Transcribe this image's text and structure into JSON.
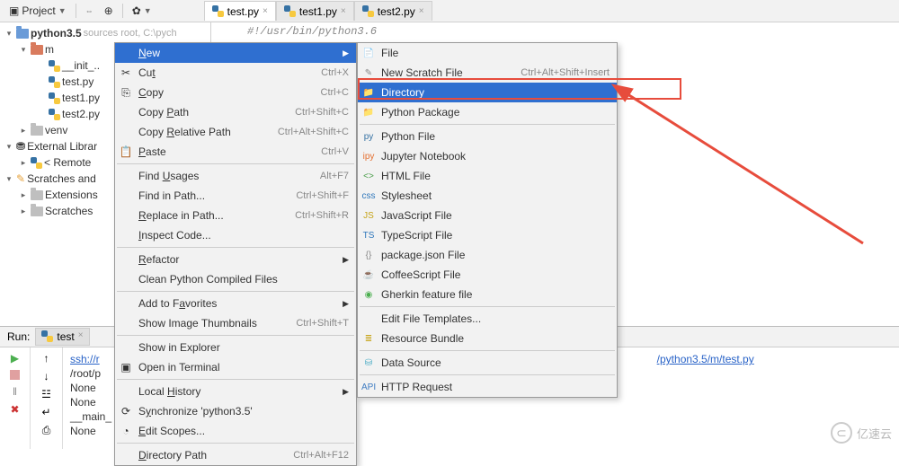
{
  "toolbar": {
    "project_label": "Project"
  },
  "tabs": [
    {
      "name": "test.py",
      "active": true
    },
    {
      "name": "test1.py",
      "active": false
    },
    {
      "name": "test2.py",
      "active": false
    }
  ],
  "tree": {
    "root": "python3.5",
    "root_hint": "sources root, C:\\pych",
    "m": "m",
    "files": [
      "__init_..",
      "test.py",
      "test1.py",
      "test2.py"
    ],
    "venv": "venv",
    "external": "External Librar",
    "remote": "< Remote",
    "scratches_root": "Scratches and",
    "extensions": "Extensions",
    "scratches": "Scratches"
  },
  "editor": {
    "line1": "#!/usr/bin/python3.6"
  },
  "context_menu": {
    "items": [
      {
        "label": "New",
        "hi": true,
        "arrow": true,
        "underline_idx": 0
      },
      {
        "label": "Cut",
        "shortcut": "Ctrl+X",
        "icon": "cut",
        "underline_idx": 2
      },
      {
        "label": "Copy",
        "shortcut": "Ctrl+C",
        "icon": "copy",
        "underline_idx": 0
      },
      {
        "label": "Copy Path",
        "shortcut": "Ctrl+Shift+C",
        "underline_idx": 5
      },
      {
        "label": "Copy Relative Path",
        "shortcut": "Ctrl+Alt+Shift+C",
        "underline_idx": 5
      },
      {
        "label": "Paste",
        "shortcut": "Ctrl+V",
        "icon": "paste",
        "underline_idx": 0
      },
      {
        "sep": true
      },
      {
        "label": "Find Usages",
        "shortcut": "Alt+F7",
        "underline_idx": 5
      },
      {
        "label": "Find in Path...",
        "shortcut": "Ctrl+Shift+F"
      },
      {
        "label": "Replace in Path...",
        "shortcut": "Ctrl+Shift+R",
        "underline_idx": 0
      },
      {
        "label": "Inspect Code...",
        "underline_idx": 0
      },
      {
        "sep": true
      },
      {
        "label": "Refactor",
        "arrow": true,
        "underline_idx": 0
      },
      {
        "label": "Clean Python Compiled Files"
      },
      {
        "sep": true
      },
      {
        "label": "Add to Favorites",
        "arrow": true,
        "underline_idx": 8
      },
      {
        "label": "Show Image Thumbnails",
        "shortcut": "Ctrl+Shift+T"
      },
      {
        "sep": true
      },
      {
        "label": "Show in Explorer"
      },
      {
        "label": "Open in Terminal",
        "icon": "terminal"
      },
      {
        "sep": true
      },
      {
        "label": "Local History",
        "arrow": true,
        "underline_idx": 6
      },
      {
        "label": "Synchronize 'python3.5'",
        "icon": "sync",
        "underline_idx": 1
      },
      {
        "label": "Edit Scopes...",
        "icon": "scope",
        "underline_idx": 0
      },
      {
        "sep": true
      },
      {
        "label": "Directory Path",
        "shortcut": "Ctrl+Alt+F12",
        "underline_idx": 0
      }
    ]
  },
  "submenu": {
    "items": [
      {
        "label": "File",
        "icon": "file-icon"
      },
      {
        "label": "New Scratch File",
        "shortcut": "Ctrl+Alt+Shift+Insert",
        "icon": "scratch-icon"
      },
      {
        "label": "Directory",
        "hi": true,
        "icon": "folder-icon"
      },
      {
        "label": "Python Package",
        "icon": "package-icon"
      },
      {
        "sep": true
      },
      {
        "label": "Python File",
        "icon": "python-icon"
      },
      {
        "label": "Jupyter Notebook",
        "icon": "jupyter-icon"
      },
      {
        "label": "HTML File",
        "icon": "html-icon"
      },
      {
        "label": "Stylesheet",
        "icon": "css-icon"
      },
      {
        "label": "JavaScript File",
        "icon": "js-icon"
      },
      {
        "label": "TypeScript File",
        "icon": "ts-icon"
      },
      {
        "label": "package.json File",
        "icon": "json-icon"
      },
      {
        "label": "CoffeeScript File",
        "icon": "coffee-icon"
      },
      {
        "label": "Gherkin feature file",
        "icon": "gherkin-icon"
      },
      {
        "sep": true
      },
      {
        "label": "Edit File Templates..."
      },
      {
        "label": "Resource Bundle",
        "icon": "bundle-icon"
      },
      {
        "sep": true
      },
      {
        "label": "Data Source",
        "icon": "db-icon"
      },
      {
        "sep": true
      },
      {
        "label": "HTTP Request",
        "icon": "http-icon"
      }
    ]
  },
  "run": {
    "label": "Run:",
    "tab": "test",
    "lines": {
      "l0a": "ssh://r",
      "l0b": "/python3.5/m/test.py",
      "l1": "/root/p",
      "l2": "None",
      "l3": "None",
      "l4": "__main_",
      "l5": "None"
    }
  },
  "watermark": "亿速云"
}
